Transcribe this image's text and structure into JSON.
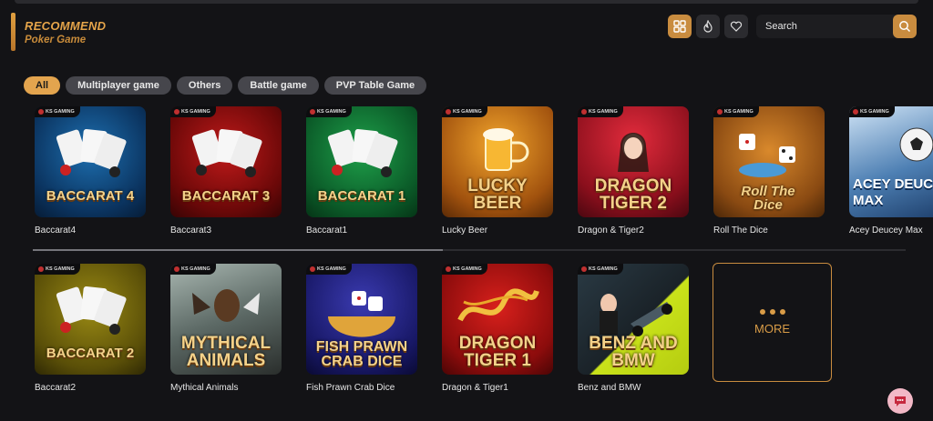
{
  "header": {
    "title": "RECOMMEND",
    "subtitle": "Poker Game"
  },
  "toolbar": {
    "grid_icon": "grid-icon",
    "hot_icon": "flame-icon",
    "fav_icon": "heart-icon",
    "search_placeholder": "Search"
  },
  "filters": [
    "All",
    "Multiplayer game",
    "Others",
    "Battle game",
    "PVP Table Game"
  ],
  "provider_badge": "KS GAMING",
  "games_row1": [
    {
      "name": "Baccarat4",
      "art": "BACCARAT 4"
    },
    {
      "name": "Baccarat3",
      "art": "BACCARAT 3"
    },
    {
      "name": "Baccarat1",
      "art": "BACCARAT 1"
    },
    {
      "name": "Lucky Beer",
      "art": "LUCKY BEER"
    },
    {
      "name": "Dragon & Tiger2",
      "art": "DRAGON TIGER 2"
    },
    {
      "name": "Roll The Dice",
      "art": "Roll The Dice"
    },
    {
      "name": "Acey Deucey Max",
      "art": "ACEY DEUCEY MAX"
    }
  ],
  "games_row2": [
    {
      "name": "Baccarat2",
      "art": "BACCARAT 2"
    },
    {
      "name": "Mythical Animals",
      "art": "MYTHICAL ANIMALS"
    },
    {
      "name": "Fish Prawn Crab Dice",
      "art": "FISH PRAWN CRAB DICE"
    },
    {
      "name": "Dragon & Tiger1",
      "art": "DRAGON TIGER 1"
    },
    {
      "name": "Benz and BMW",
      "art": "BENZ AND BMW"
    }
  ],
  "more_label": "MORE",
  "carousel_progress": 0.47,
  "colors": {
    "accent": "#c98c3f",
    "background": "#131316",
    "chip": "#46464c"
  }
}
